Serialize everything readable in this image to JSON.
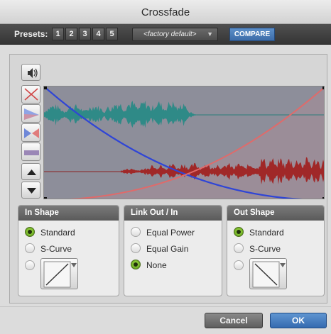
{
  "window": {
    "title": "Crossfade"
  },
  "toolbar": {
    "presets_label": "Presets:",
    "preset_numbers": [
      "1",
      "2",
      "3",
      "4",
      "5"
    ],
    "preset_value": "<factory default>",
    "compare_label": "COMPARE"
  },
  "tools": [
    "speaker-icon",
    "no-fade-icon",
    "fade-out-icon",
    "fade-in-icon",
    "fade-flat-icon",
    "arrow-up-icon",
    "arrow-down-icon"
  ],
  "in_shape": {
    "title": "In Shape",
    "options": [
      "Standard",
      "S-Curve"
    ],
    "selected": "Standard"
  },
  "link": {
    "title": "Link Out / In",
    "options": [
      "Equal Power",
      "Equal Gain",
      "None"
    ],
    "selected": "None"
  },
  "out_shape": {
    "title": "Out Shape",
    "options": [
      "Standard",
      "S-Curve"
    ],
    "selected": "Standard"
  },
  "colors": {
    "selected_radio": "#7ab92c",
    "compare_blue": "#4a7fbf",
    "fade_in_curve": "#e06a6a",
    "fade_out_curve": "#2f45d6",
    "upper_wave": "#2f8a87",
    "lower_wave": "#a02828"
  },
  "footer": {
    "cancel_label": "Cancel",
    "ok_label": "OK"
  }
}
